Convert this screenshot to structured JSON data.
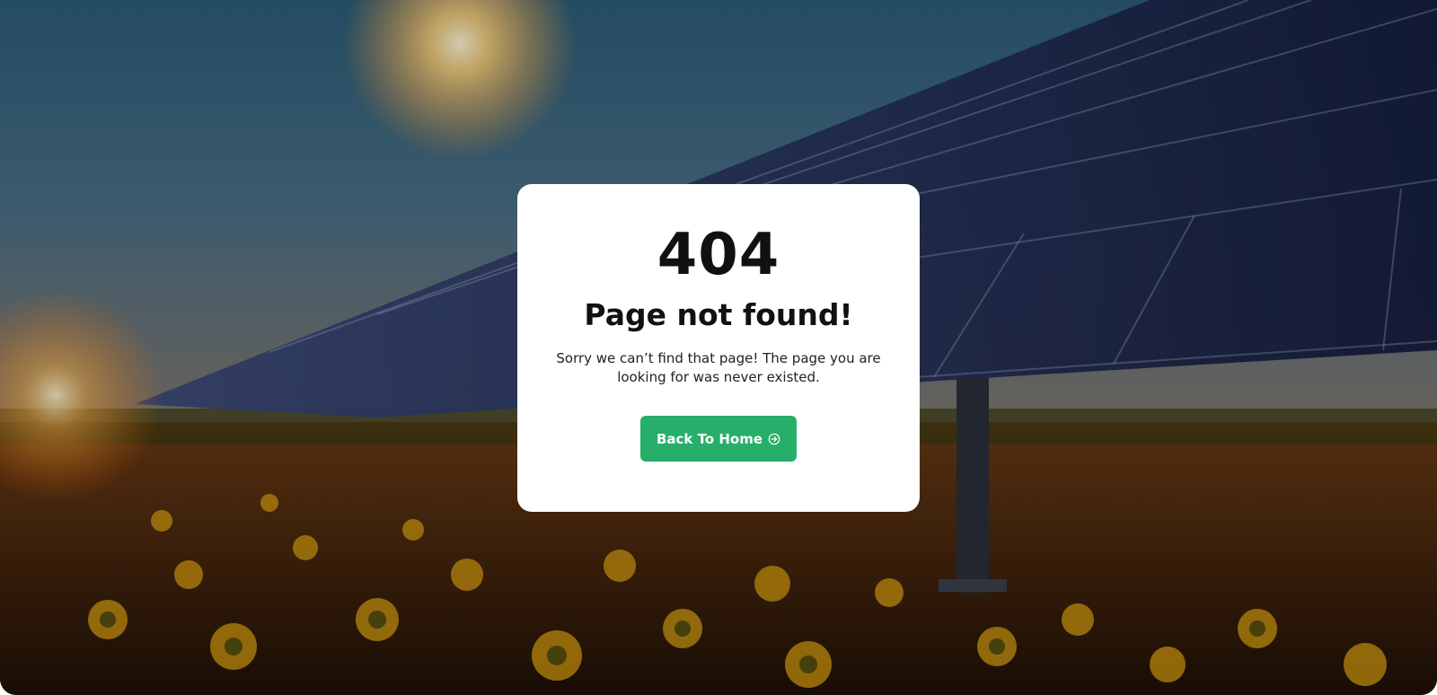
{
  "error": {
    "code": "404",
    "title": "Page not found!",
    "message": "Sorry we can’t find that page! The page you are looking for was never existed."
  },
  "actions": {
    "back_home_label": "Back To Home",
    "back_home_icon": "arrow-right-circle-icon"
  },
  "colors": {
    "button_bg": "#27ae6b",
    "card_bg": "#ffffff",
    "text": "#111111"
  },
  "background": {
    "image_subject": "solar-panels-sunflower-field-sunset"
  }
}
